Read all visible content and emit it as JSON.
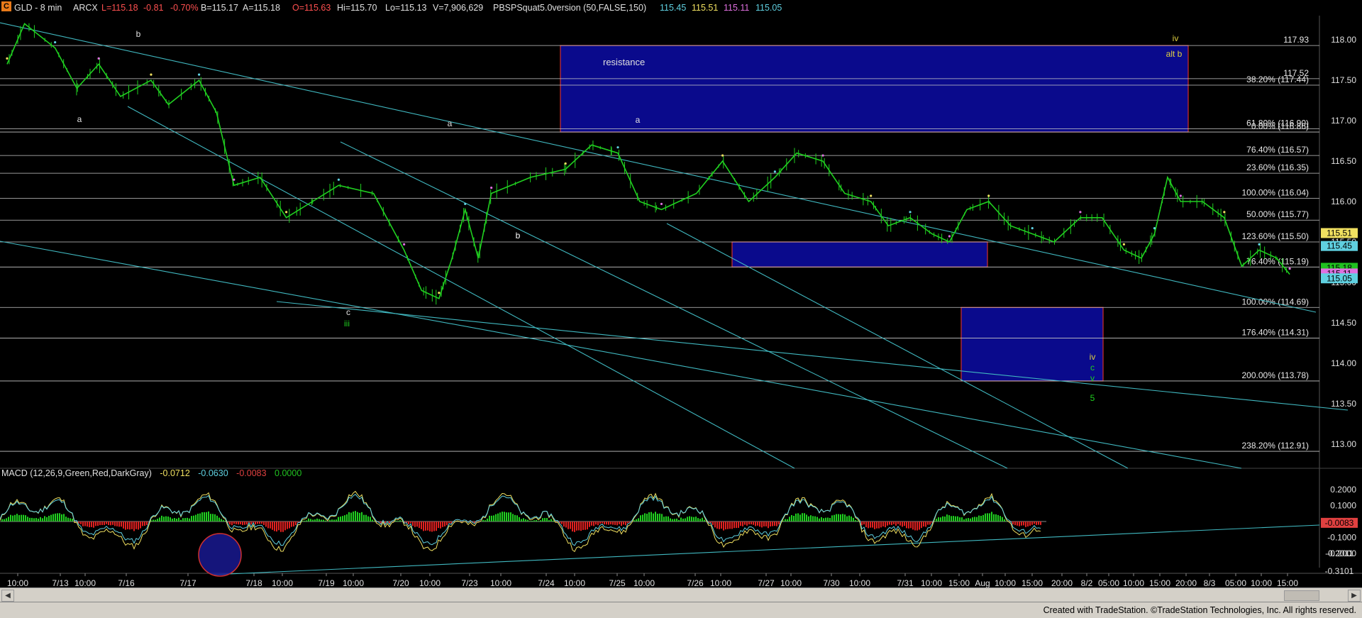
{
  "header": {
    "symbol": "GLD - 8 min",
    "exchange": "ARCX",
    "last": "L=115.18",
    "change": "-0.81",
    "change_pct": "-0.70%",
    "bid": "B=115.17",
    "ask": "A=115.18",
    "open": "O=115.63",
    "high": "Hi=115.70",
    "low": "Lo=115.13",
    "volume": "V=7,906,629",
    "study": "PBSPSquat5.0version (50,FALSE,150)",
    "study_values": [
      "115.45",
      "115.51",
      "115.11",
      "115.05"
    ],
    "study_colors": [
      "#5fd0e0",
      "#f0e060",
      "#e070e0",
      "#5fd0e0"
    ]
  },
  "macd_header": {
    "label": "MACD (12,26,9,Green,Red,DarkGray)",
    "values": [
      "-0.0712",
      "-0.0630",
      "-0.0083",
      "0.0000"
    ],
    "colors": [
      "#f0e060",
      "#5fd0e0",
      "#e04040",
      "#20c020"
    ]
  },
  "footer": {
    "credit": "Created with TradeStation. ©TradeStation Technologies, Inc. All rights reserved."
  },
  "chart_data": {
    "type": "line",
    "title": "GLD - 8 min",
    "price_axis": {
      "ticks": [
        "118.00",
        "117.50",
        "117.00",
        "116.50",
        "116.00",
        "115.50",
        "115.00",
        "114.50",
        "114.00",
        "113.50",
        "113.00"
      ],
      "ylim": [
        112.7,
        118.3
      ]
    },
    "macd_axis": {
      "ticks": [
        "0.2000",
        "0.1000",
        "-0.1000",
        "-0.2000"
      ]
    },
    "x_ticks": [
      "10:00",
      "7/13",
      "10:00",
      "7/16",
      "7/17",
      "7/18",
      "10:00",
      "7/19",
      "10:00",
      "7/20",
      "10:00",
      "7/23",
      "10:00",
      "7/24",
      "10:00",
      "7/25",
      "10:00",
      "7/26",
      "10:00",
      "7/27",
      "10:00",
      "7/30",
      "10:00",
      "7/31",
      "10:00",
      "15:00",
      "Aug",
      "10:00",
      "15:00",
      "20:00",
      "8/2",
      "05:00",
      "10:00",
      "15:00",
      "20:00",
      "8/3",
      "05:00",
      "10:00",
      "15:00"
    ],
    "fib_levels": [
      {
        "label": "117.93",
        "value": 117.93
      },
      {
        "label": "117.52",
        "value": 117.52
      },
      {
        "label": "38.20% (117.44)",
        "value": 117.44
      },
      {
        "label": "61.80% (116.90)",
        "value": 116.9
      },
      {
        "label": "0.00% (116.86)",
        "value": 116.86
      },
      {
        "label": "76.40% (116.57)",
        "value": 116.57
      },
      {
        "label": "23.60% (116.35)",
        "value": 116.35
      },
      {
        "label": "100.00% (116.04)",
        "value": 116.04
      },
      {
        "label": "50.00% (115.77)",
        "value": 115.77
      },
      {
        "label": "123.60% (115.50)",
        "value": 115.5
      },
      {
        "label": "76.40% (115.19)",
        "value": 115.19
      },
      {
        "label": "100.00% (114.69)",
        "value": 114.69
      },
      {
        "label": "176.40% (114.31)",
        "value": 114.31
      },
      {
        "label": "200.00% (113.78)",
        "value": 113.78
      },
      {
        "label": "238.20% (112.91)",
        "value": 112.91
      }
    ],
    "price_badges": [
      {
        "label": "115.51",
        "color": "#f0e060"
      },
      {
        "label": "115.45",
        "color": "#5fd0e0"
      },
      {
        "label": "115.18",
        "color": "#20c020"
      },
      {
        "label": "115.11",
        "color": "#e070e0"
      },
      {
        "label": "115.05",
        "color": "#5fd0e0"
      }
    ],
    "macd_badges": [
      {
        "label": "-0.0083",
        "color": "#e04040"
      },
      {
        "label": "-0.2011",
        "color": "#000000"
      },
      {
        "label": "-0.3101",
        "color": "#000000"
      }
    ],
    "zones": [
      {
        "label": "resistance",
        "y_top": 117.93,
        "y_bottom": 116.86
      },
      {
        "label": "",
        "y_top": 115.5,
        "y_bottom": 115.19
      },
      {
        "label": "",
        "y_top": 114.69,
        "y_bottom": 113.78
      }
    ],
    "wave_labels": [
      "b",
      "a",
      "a",
      "b",
      "c",
      "iii",
      "a",
      "b",
      "iv",
      "alt b",
      "iv",
      "c",
      "v",
      "5",
      "c",
      "2"
    ],
    "series": [
      {
        "name": "price",
        "points": [
          [
            0,
            117.7
          ],
          [
            20,
            118.2
          ],
          [
            55,
            117.9
          ],
          [
            80,
            117.4
          ],
          [
            105,
            117.7
          ],
          [
            130,
            117.3
          ],
          [
            165,
            117.5
          ],
          [
            185,
            117.2
          ],
          [
            220,
            117.5
          ],
          [
            240,
            117.1
          ],
          [
            260,
            116.2
          ],
          [
            290,
            116.3
          ],
          [
            320,
            115.8
          ],
          [
            350,
            116.0
          ],
          [
            380,
            116.2
          ],
          [
            420,
            116.1
          ],
          [
            455,
            115.4
          ],
          [
            475,
            114.9
          ],
          [
            495,
            114.8
          ],
          [
            510,
            115.3
          ],
          [
            525,
            115.9
          ],
          [
            540,
            115.3
          ],
          [
            555,
            116.1
          ],
          [
            600,
            116.3
          ],
          [
            640,
            116.4
          ],
          [
            670,
            116.7
          ],
          [
            700,
            116.6
          ],
          [
            725,
            116.0
          ],
          [
            750,
            115.9
          ],
          [
            790,
            116.1
          ],
          [
            820,
            116.5
          ],
          [
            850,
            116.0
          ],
          [
            880,
            116.3
          ],
          [
            905,
            116.6
          ],
          [
            935,
            116.5
          ],
          [
            960,
            116.1
          ],
          [
            990,
            116.0
          ],
          [
            1010,
            115.7
          ],
          [
            1035,
            115.8
          ],
          [
            1060,
            115.6
          ],
          [
            1080,
            115.5
          ],
          [
            1100,
            115.9
          ],
          [
            1125,
            116.0
          ],
          [
            1150,
            115.7
          ],
          [
            1175,
            115.6
          ],
          [
            1200,
            115.5
          ],
          [
            1230,
            115.8
          ],
          [
            1255,
            115.8
          ],
          [
            1280,
            115.4
          ],
          [
            1300,
            115.3
          ],
          [
            1315,
            115.6
          ],
          [
            1330,
            116.3
          ],
          [
            1345,
            116.0
          ],
          [
            1370,
            116.0
          ],
          [
            1395,
            115.8
          ],
          [
            1415,
            115.2
          ],
          [
            1435,
            115.4
          ],
          [
            1455,
            115.3
          ],
          [
            1470,
            115.1
          ]
        ]
      },
      {
        "name": "macd",
        "points": []
      }
    ]
  }
}
